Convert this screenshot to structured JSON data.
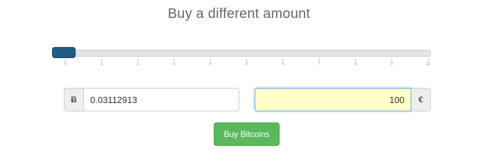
{
  "heading": "Buy a different amount",
  "slider": {
    "value": 0,
    "min": 0,
    "max": 10,
    "ticks": [
      "0",
      "1",
      "2",
      "3",
      "4",
      "5",
      "6",
      "7",
      "8",
      "9",
      "10"
    ],
    "handle_color": "#1f5c86"
  },
  "btc_input": {
    "currency_symbol": "Ƀ",
    "value": "0.03112913"
  },
  "eur_input": {
    "currency_symbol": "€",
    "value": "100",
    "highlight_color": "#ffffc8"
  },
  "buy_button": {
    "label": "Buy Bitcoins",
    "color": "#5cb85c"
  }
}
